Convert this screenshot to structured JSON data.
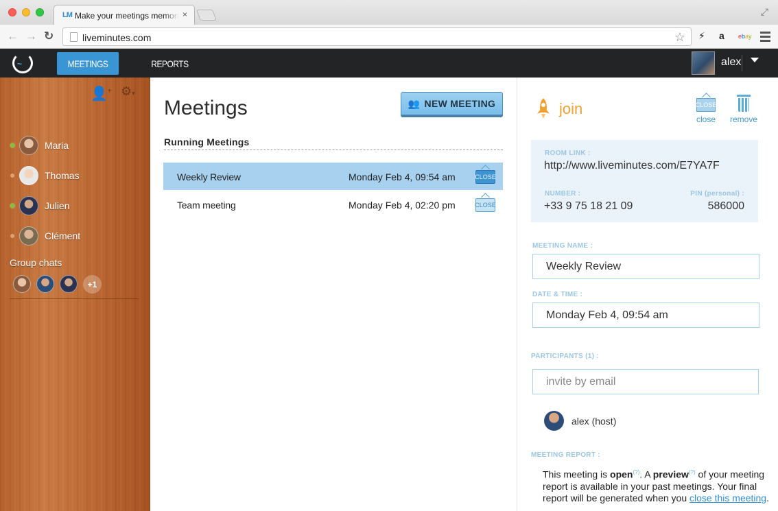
{
  "browser": {
    "tab_title": "Make your meetings memorable",
    "tab_favicon": "LM",
    "tab_close": "×",
    "url": "liveminutes.com"
  },
  "appbar": {
    "nav_meetings": "MEETINGS",
    "nav_reports": "REPORTS",
    "user_name": "alex"
  },
  "sidebar": {
    "contacts": [
      {
        "name": "Maria",
        "status": "online"
      },
      {
        "name": "Thomas",
        "status": "offline"
      },
      {
        "name": "Julien",
        "status": "online"
      },
      {
        "name": "Clément",
        "status": "offline"
      }
    ],
    "group_chats_title": "Group chats",
    "group_more": "+1"
  },
  "meetings": {
    "title": "Meetings",
    "new_meeting_label": "NEW MEETING",
    "running_title": "Running Meetings",
    "close_label": "CLOSE",
    "rows": [
      {
        "name": "Weekly Review",
        "date": "Monday Feb 4, 09:54 am",
        "selected": true
      },
      {
        "name": "Team meeting",
        "date": "Monday Feb 4, 02:20 pm",
        "selected": false
      }
    ]
  },
  "detail": {
    "join_label": "join",
    "close_sign": "CLOSE",
    "close_label": "close",
    "remove_label": "remove",
    "room_link_label": "ROOM LINK :",
    "room_link": "http://www.liveminutes.com/E7YA7F",
    "number_label": "NUMBER :",
    "number": "+33 9 75 18 21 09",
    "pin_label": "PIN (personal) :",
    "pin": "586000",
    "meeting_name_label": "MEETING NAME :",
    "meeting_name": "Weekly Review",
    "date_label": "DATE & TIME :",
    "date_value": "Monday Feb 4, 09:54 am",
    "participants_label": "PARTICIPANTS (1) :",
    "invite_placeholder": "invite by email",
    "host": "alex (host)",
    "report_label": "MEETING REPORT :",
    "report_p1": "This meeting is ",
    "report_open": "open",
    "report_q": "(?)",
    "report_p2": ". A ",
    "report_preview": "preview",
    "report_p3": " of your meeting report is available in your past meetings. Your final report will be generated when you ",
    "report_link": "close this meeting",
    "report_end": "."
  },
  "colors": {
    "accent": "#3a95d5",
    "join": "#f0a030",
    "appbar": "#222426",
    "selected_row": "#a8d1ef"
  }
}
